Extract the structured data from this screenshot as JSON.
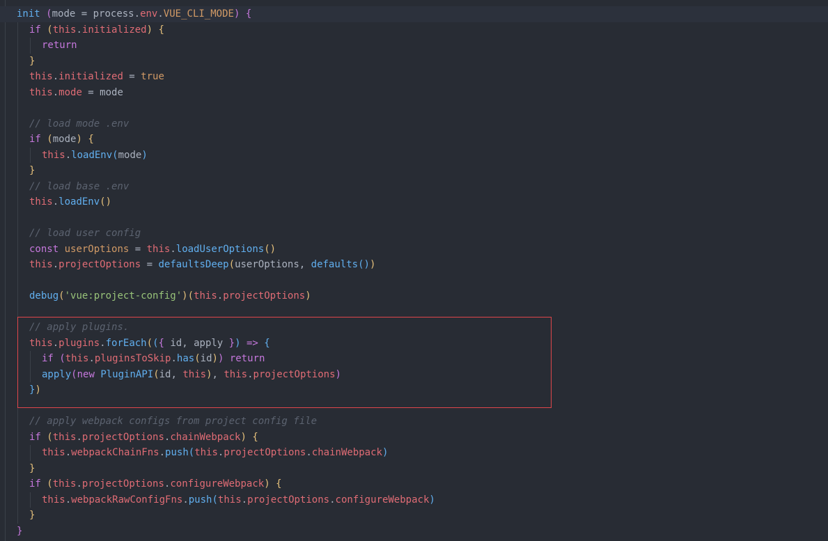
{
  "colors": {
    "background": "#282c34",
    "keyword": "#c678dd",
    "this": "#e06c75",
    "property": "#e06c75",
    "function": "#61afef",
    "string": "#98c379",
    "constant": "#d19a66",
    "comment": "#5c6370",
    "plain": "#abb2bf",
    "bracket1": "#c678dd",
    "bracket2": "#e5c07b",
    "bracket3": "#61afef",
    "highlight_border": "#e0464b"
  },
  "lines": [
    {
      "indent": 0,
      "active": true,
      "tokens": [
        {
          "t": "init",
          "c": "function"
        },
        {
          "t": " ",
          "c": "plain"
        },
        {
          "t": "(",
          "c": "bracket1"
        },
        {
          "t": "mode",
          "c": "plain"
        },
        {
          "t": " = ",
          "c": "plain"
        },
        {
          "t": "process",
          "c": "plain"
        },
        {
          "t": ".",
          "c": "plain"
        },
        {
          "t": "env",
          "c": "property"
        },
        {
          "t": ".",
          "c": "plain"
        },
        {
          "t": "VUE_CLI_MODE",
          "c": "constant"
        },
        {
          "t": ")",
          "c": "bracket1"
        },
        {
          "t": " ",
          "c": "plain"
        },
        {
          "t": "{",
          "c": "bracket1"
        }
      ]
    },
    {
      "indent": 1,
      "tokens": [
        {
          "t": "if",
          "c": "keyword"
        },
        {
          "t": " ",
          "c": "plain"
        },
        {
          "t": "(",
          "c": "bracket2"
        },
        {
          "t": "this",
          "c": "this"
        },
        {
          "t": ".",
          "c": "plain"
        },
        {
          "t": "initialized",
          "c": "property"
        },
        {
          "t": ")",
          "c": "bracket2"
        },
        {
          "t": " ",
          "c": "plain"
        },
        {
          "t": "{",
          "c": "bracket2"
        }
      ]
    },
    {
      "indent": 2,
      "tokens": [
        {
          "t": "return",
          "c": "keyword"
        }
      ]
    },
    {
      "indent": 1,
      "tokens": [
        {
          "t": "}",
          "c": "bracket2"
        }
      ]
    },
    {
      "indent": 1,
      "tokens": [
        {
          "t": "this",
          "c": "this"
        },
        {
          "t": ".",
          "c": "plain"
        },
        {
          "t": "initialized",
          "c": "property"
        },
        {
          "t": " = ",
          "c": "plain"
        },
        {
          "t": "true",
          "c": "constant"
        }
      ]
    },
    {
      "indent": 1,
      "tokens": [
        {
          "t": "this",
          "c": "this"
        },
        {
          "t": ".",
          "c": "plain"
        },
        {
          "t": "mode",
          "c": "property"
        },
        {
          "t": " = ",
          "c": "plain"
        },
        {
          "t": "mode",
          "c": "plain"
        }
      ]
    },
    {
      "indent": 1,
      "tokens": []
    },
    {
      "indent": 1,
      "tokens": [
        {
          "t": "// load mode .env",
          "c": "comment"
        }
      ]
    },
    {
      "indent": 1,
      "tokens": [
        {
          "t": "if",
          "c": "keyword"
        },
        {
          "t": " ",
          "c": "plain"
        },
        {
          "t": "(",
          "c": "bracket2"
        },
        {
          "t": "mode",
          "c": "plain"
        },
        {
          "t": ")",
          "c": "bracket2"
        },
        {
          "t": " ",
          "c": "plain"
        },
        {
          "t": "{",
          "c": "bracket2"
        }
      ]
    },
    {
      "indent": 2,
      "tokens": [
        {
          "t": "this",
          "c": "this"
        },
        {
          "t": ".",
          "c": "plain"
        },
        {
          "t": "loadEnv",
          "c": "function"
        },
        {
          "t": "(",
          "c": "bracket3"
        },
        {
          "t": "mode",
          "c": "plain"
        },
        {
          "t": ")",
          "c": "bracket3"
        }
      ]
    },
    {
      "indent": 1,
      "tokens": [
        {
          "t": "}",
          "c": "bracket2"
        }
      ]
    },
    {
      "indent": 1,
      "tokens": [
        {
          "t": "// load base .env",
          "c": "comment"
        }
      ]
    },
    {
      "indent": 1,
      "tokens": [
        {
          "t": "this",
          "c": "this"
        },
        {
          "t": ".",
          "c": "plain"
        },
        {
          "t": "loadEnv",
          "c": "function"
        },
        {
          "t": "()",
          "c": "bracket2"
        }
      ]
    },
    {
      "indent": 1,
      "tokens": []
    },
    {
      "indent": 1,
      "tokens": [
        {
          "t": "// load user config",
          "c": "comment"
        }
      ]
    },
    {
      "indent": 1,
      "tokens": [
        {
          "t": "const",
          "c": "keyword"
        },
        {
          "t": " ",
          "c": "plain"
        },
        {
          "t": "userOptions",
          "c": "constant"
        },
        {
          "t": " = ",
          "c": "plain"
        },
        {
          "t": "this",
          "c": "this"
        },
        {
          "t": ".",
          "c": "plain"
        },
        {
          "t": "loadUserOptions",
          "c": "function"
        },
        {
          "t": "()",
          "c": "bracket2"
        }
      ]
    },
    {
      "indent": 1,
      "tokens": [
        {
          "t": "this",
          "c": "this"
        },
        {
          "t": ".",
          "c": "plain"
        },
        {
          "t": "projectOptions",
          "c": "property"
        },
        {
          "t": " = ",
          "c": "plain"
        },
        {
          "t": "defaultsDeep",
          "c": "function"
        },
        {
          "t": "(",
          "c": "bracket2"
        },
        {
          "t": "userOptions",
          "c": "plain"
        },
        {
          "t": ", ",
          "c": "plain"
        },
        {
          "t": "defaults",
          "c": "function"
        },
        {
          "t": "()",
          "c": "bracket3"
        },
        {
          "t": ")",
          "c": "bracket2"
        }
      ]
    },
    {
      "indent": 1,
      "tokens": []
    },
    {
      "indent": 1,
      "tokens": [
        {
          "t": "debug",
          "c": "function"
        },
        {
          "t": "(",
          "c": "bracket2"
        },
        {
          "t": "'vue:project-config'",
          "c": "string"
        },
        {
          "t": ")",
          "c": "bracket2"
        },
        {
          "t": "(",
          "c": "bracket2"
        },
        {
          "t": "this",
          "c": "this"
        },
        {
          "t": ".",
          "c": "plain"
        },
        {
          "t": "projectOptions",
          "c": "property"
        },
        {
          "t": ")",
          "c": "bracket2"
        }
      ]
    },
    {
      "indent": 1,
      "tokens": []
    },
    {
      "indent": 1,
      "tokens": [
        {
          "t": "// apply plugins.",
          "c": "comment"
        }
      ]
    },
    {
      "indent": 1,
      "tokens": [
        {
          "t": "this",
          "c": "this"
        },
        {
          "t": ".",
          "c": "plain"
        },
        {
          "t": "plugins",
          "c": "property"
        },
        {
          "t": ".",
          "c": "plain"
        },
        {
          "t": "forEach",
          "c": "function"
        },
        {
          "t": "(",
          "c": "bracket2"
        },
        {
          "t": "(",
          "c": "bracket3"
        },
        {
          "t": "{",
          "c": "bracket1"
        },
        {
          "t": " id, apply ",
          "c": "plain"
        },
        {
          "t": "}",
          "c": "bracket1"
        },
        {
          "t": ")",
          "c": "bracket3"
        },
        {
          "t": " ",
          "c": "plain"
        },
        {
          "t": "=>",
          "c": "keyword"
        },
        {
          "t": " ",
          "c": "plain"
        },
        {
          "t": "{",
          "c": "bracket3"
        }
      ]
    },
    {
      "indent": 2,
      "tokens": [
        {
          "t": "if",
          "c": "keyword"
        },
        {
          "t": " ",
          "c": "plain"
        },
        {
          "t": "(",
          "c": "bracket1"
        },
        {
          "t": "this",
          "c": "this"
        },
        {
          "t": ".",
          "c": "plain"
        },
        {
          "t": "pluginsToSkip",
          "c": "property"
        },
        {
          "t": ".",
          "c": "plain"
        },
        {
          "t": "has",
          "c": "function"
        },
        {
          "t": "(",
          "c": "bracket2"
        },
        {
          "t": "id",
          "c": "plain"
        },
        {
          "t": ")",
          "c": "bracket2"
        },
        {
          "t": ")",
          "c": "bracket1"
        },
        {
          "t": " ",
          "c": "plain"
        },
        {
          "t": "return",
          "c": "keyword"
        }
      ]
    },
    {
      "indent": 2,
      "tokens": [
        {
          "t": "apply",
          "c": "function"
        },
        {
          "t": "(",
          "c": "bracket1"
        },
        {
          "t": "new",
          "c": "keyword"
        },
        {
          "t": " ",
          "c": "plain"
        },
        {
          "t": "PluginAPI",
          "c": "function"
        },
        {
          "t": "(",
          "c": "bracket2"
        },
        {
          "t": "id, ",
          "c": "plain"
        },
        {
          "t": "this",
          "c": "this"
        },
        {
          "t": ")",
          "c": "bracket2"
        },
        {
          "t": ", ",
          "c": "plain"
        },
        {
          "t": "this",
          "c": "this"
        },
        {
          "t": ".",
          "c": "plain"
        },
        {
          "t": "projectOptions",
          "c": "property"
        },
        {
          "t": ")",
          "c": "bracket1"
        }
      ]
    },
    {
      "indent": 1,
      "tokens": [
        {
          "t": "}",
          "c": "bracket3"
        },
        {
          "t": ")",
          "c": "bracket2"
        }
      ]
    },
    {
      "indent": 1,
      "tokens": []
    },
    {
      "indent": 1,
      "tokens": [
        {
          "t": "// apply webpack configs from project config file",
          "c": "comment"
        }
      ]
    },
    {
      "indent": 1,
      "tokens": [
        {
          "t": "if",
          "c": "keyword"
        },
        {
          "t": " ",
          "c": "plain"
        },
        {
          "t": "(",
          "c": "bracket2"
        },
        {
          "t": "this",
          "c": "this"
        },
        {
          "t": ".",
          "c": "plain"
        },
        {
          "t": "projectOptions",
          "c": "property"
        },
        {
          "t": ".",
          "c": "plain"
        },
        {
          "t": "chainWebpack",
          "c": "property"
        },
        {
          "t": ")",
          "c": "bracket2"
        },
        {
          "t": " ",
          "c": "plain"
        },
        {
          "t": "{",
          "c": "bracket2"
        }
      ]
    },
    {
      "indent": 2,
      "tokens": [
        {
          "t": "this",
          "c": "this"
        },
        {
          "t": ".",
          "c": "plain"
        },
        {
          "t": "webpackChainFns",
          "c": "property"
        },
        {
          "t": ".",
          "c": "plain"
        },
        {
          "t": "push",
          "c": "function"
        },
        {
          "t": "(",
          "c": "bracket3"
        },
        {
          "t": "this",
          "c": "this"
        },
        {
          "t": ".",
          "c": "plain"
        },
        {
          "t": "projectOptions",
          "c": "property"
        },
        {
          "t": ".",
          "c": "plain"
        },
        {
          "t": "chainWebpack",
          "c": "property"
        },
        {
          "t": ")",
          "c": "bracket3"
        }
      ]
    },
    {
      "indent": 1,
      "tokens": [
        {
          "t": "}",
          "c": "bracket2"
        }
      ]
    },
    {
      "indent": 1,
      "tokens": [
        {
          "t": "if",
          "c": "keyword"
        },
        {
          "t": " ",
          "c": "plain"
        },
        {
          "t": "(",
          "c": "bracket2"
        },
        {
          "t": "this",
          "c": "this"
        },
        {
          "t": ".",
          "c": "plain"
        },
        {
          "t": "projectOptions",
          "c": "property"
        },
        {
          "t": ".",
          "c": "plain"
        },
        {
          "t": "configureWebpack",
          "c": "property"
        },
        {
          "t": ")",
          "c": "bracket2"
        },
        {
          "t": " ",
          "c": "plain"
        },
        {
          "t": "{",
          "c": "bracket2"
        }
      ]
    },
    {
      "indent": 2,
      "tokens": [
        {
          "t": "this",
          "c": "this"
        },
        {
          "t": ".",
          "c": "plain"
        },
        {
          "t": "webpackRawConfigFns",
          "c": "property"
        },
        {
          "t": ".",
          "c": "plain"
        },
        {
          "t": "push",
          "c": "function"
        },
        {
          "t": "(",
          "c": "bracket3"
        },
        {
          "t": "this",
          "c": "this"
        },
        {
          "t": ".",
          "c": "plain"
        },
        {
          "t": "projectOptions",
          "c": "property"
        },
        {
          "t": ".",
          "c": "plain"
        },
        {
          "t": "configureWebpack",
          "c": "property"
        },
        {
          "t": ")",
          "c": "bracket3"
        }
      ]
    },
    {
      "indent": 1,
      "tokens": [
        {
          "t": "}",
          "c": "bracket2"
        }
      ]
    },
    {
      "indent": 0,
      "tokens": [
        {
          "t": "}",
          "c": "bracket1"
        }
      ]
    }
  ]
}
